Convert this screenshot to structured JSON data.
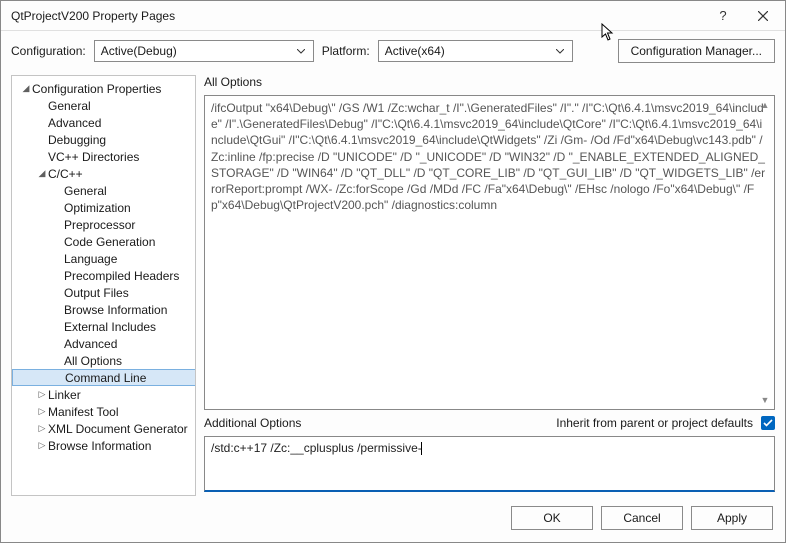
{
  "window": {
    "title": "QtProjectV200 Property Pages",
    "help_icon": "?",
    "close_icon": "×"
  },
  "config_row": {
    "configuration_label": "Configuration:",
    "configuration_value": "Active(Debug)",
    "platform_label": "Platform:",
    "platform_value": "Active(x64)",
    "manager_button": "Configuration Manager..."
  },
  "tree": {
    "root": "Configuration Properties",
    "items_l1": [
      "General",
      "Advanced",
      "Debugging",
      "VC++ Directories"
    ],
    "cpp": "C/C++",
    "cpp_children": [
      "General",
      "Optimization",
      "Preprocessor",
      "Code Generation",
      "Language",
      "Precompiled Headers",
      "Output Files",
      "Browse Information",
      "External Includes",
      "Advanced",
      "All Options",
      "Command Line"
    ],
    "after_cpp": [
      "Linker",
      "Manifest Tool",
      "XML Document Generator",
      "Browse Information"
    ]
  },
  "main": {
    "all_options_label": "All Options",
    "all_options_text": "/ifcOutput \"x64\\Debug\\\" /GS /W1 /Zc:wchar_t /I\".\\GeneratedFiles\" /I\".\" /I\"C:\\Qt\\6.4.1\\msvc2019_64\\include\" /I\".\\GeneratedFiles\\Debug\" /I\"C:\\Qt\\6.4.1\\msvc2019_64\\include\\QtCore\" /I\"C:\\Qt\\6.4.1\\msvc2019_64\\include\\QtGui\" /I\"C:\\Qt\\6.4.1\\msvc2019_64\\include\\QtWidgets\" /Zi /Gm- /Od /Fd\"x64\\Debug\\vc143.pdb\" /Zc:inline /fp:precise /D \"UNICODE\" /D \"_UNICODE\" /D \"WIN32\" /D \"_ENABLE_EXTENDED_ALIGNED_STORAGE\" /D \"WIN64\" /D \"QT_DLL\" /D \"QT_CORE_LIB\" /D \"QT_GUI_LIB\" /D \"QT_WIDGETS_LIB\" /errorReport:prompt /WX- /Zc:forScope /Gd /MDd /FC /Fa\"x64\\Debug\\\" /EHsc /nologo /Fo\"x64\\Debug\\\" /Fp\"x64\\Debug\\QtProjectV200.pch\" /diagnostics:column",
    "additional_options_label": "Additional Options",
    "inherit_label": "Inherit from parent or project defaults",
    "inherit_checked": true,
    "additional_options_value": "/std:c++17 /Zc:__cplusplus /permissive-"
  },
  "footer": {
    "ok": "OK",
    "cancel": "Cancel",
    "apply": "Apply"
  }
}
